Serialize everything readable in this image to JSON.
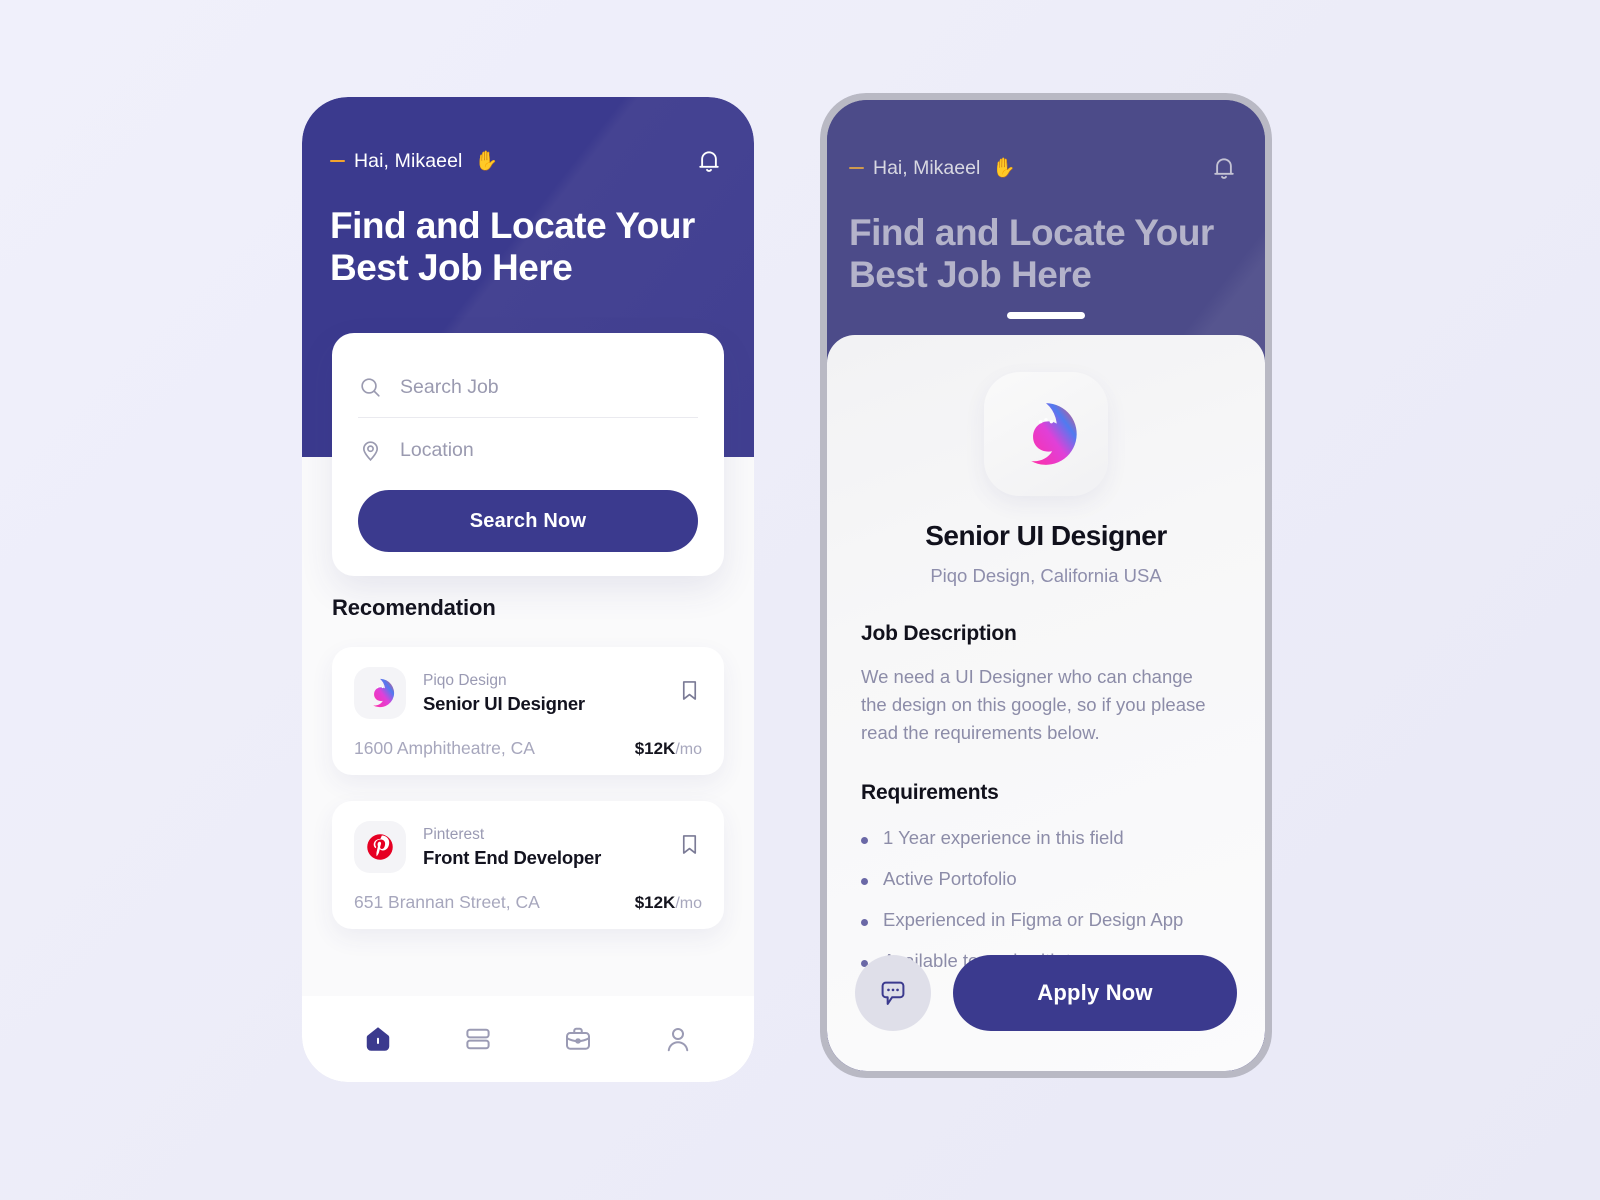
{
  "theme": {
    "page_background": "#eeeef9",
    "brand_purple": "#3b3a8e",
    "dimmed_purple": "#4c4b89",
    "accent_orange": "#f2a32c",
    "muted_text": "#8c8ca8",
    "dark_text": "#11111c"
  },
  "phone_one": {
    "greeting": "Hai, Mikaeel",
    "greeting_wave": "✋",
    "bell_icon": "bell-icon",
    "hero_title": "Find and Locate Your Best Job Here",
    "search": {
      "job_placeholder": "Search Job",
      "job_icon": "search-icon",
      "location_placeholder": "Location",
      "location_icon": "map-pin-icon",
      "button_label": "Search Now"
    },
    "section_title": "Recomendation",
    "jobs": [
      {
        "company": "Piqo Design",
        "role": "Senior UI Designer",
        "address": "1600 Amphitheatre, CA",
        "salary": "$12K",
        "salary_period": "/mo",
        "logo": "piqo-peacock-logo",
        "bookmark_icon": "bookmark-icon"
      },
      {
        "company": "Pinterest",
        "role": "Front End Developer",
        "address": "651 Brannan Street, CA",
        "salary": "$12K",
        "salary_period": "/mo",
        "logo": "pinterest-logo",
        "bookmark_icon": "bookmark-icon"
      }
    ],
    "nav": [
      {
        "name": "home",
        "icon": "home-icon",
        "active": true
      },
      {
        "name": "feed",
        "icon": "list-rows-icon",
        "active": false
      },
      {
        "name": "jobs",
        "icon": "briefcase-icon",
        "active": false
      },
      {
        "name": "profile",
        "icon": "person-icon",
        "active": false
      }
    ]
  },
  "phone_two": {
    "greeting": "Hai, Mikaeel",
    "greeting_wave": "✋",
    "bell_icon": "bell-icon",
    "hero_title": "Find and Locate Your Best Job Here",
    "detail": {
      "logo": "piqo-peacock-logo",
      "title": "Senior UI Designer",
      "subtitle": "Piqo Design, California USA",
      "description_heading": "Job Description",
      "description_body": "We need a UI Designer who can change the design on this google, so if you please read the requirements below.",
      "requirements_heading": "Requirements",
      "requirements": [
        "1 Year experience in this field",
        "Active Portofolio",
        "Experienced in Figma or Design App",
        "Available to work with team"
      ],
      "chat_icon": "chat-bubble-icon",
      "apply_label": "Apply Now"
    }
  }
}
